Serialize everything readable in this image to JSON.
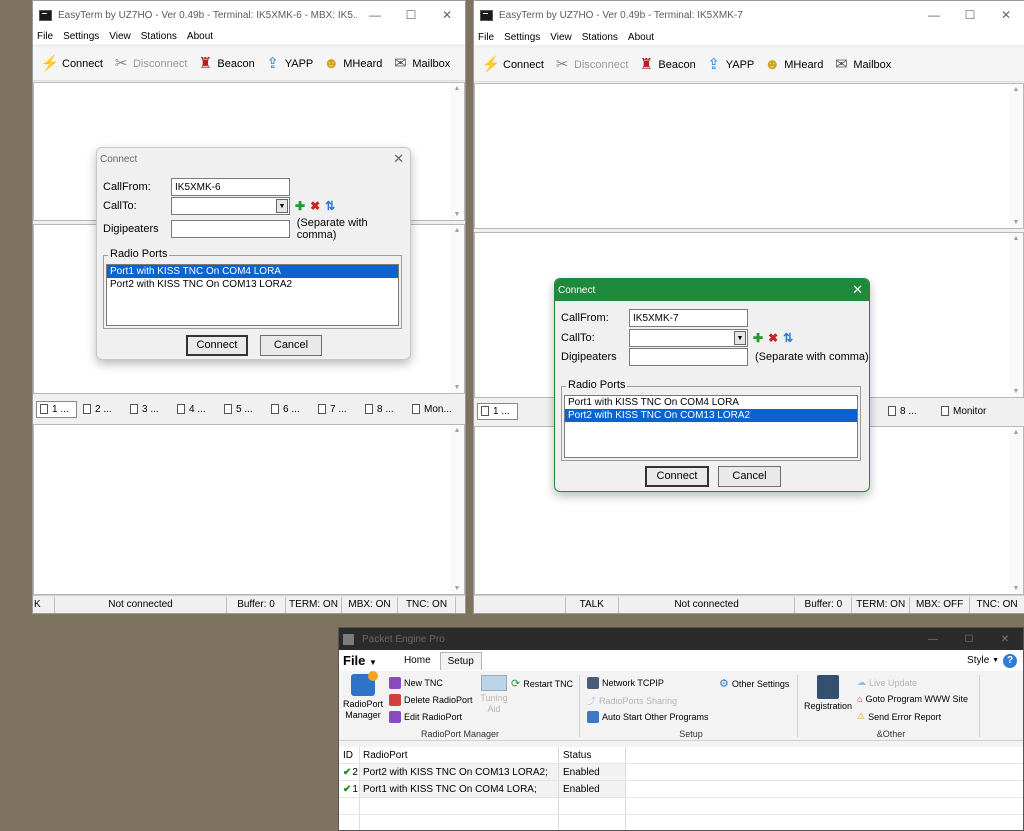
{
  "menu": [
    "File",
    "Settings",
    "View",
    "Stations",
    "About"
  ],
  "toolbar": {
    "connect": "Connect",
    "disconnect": "Disconnect",
    "beacon": "Beacon",
    "yapp": "YAPP",
    "mheard": "MHeard",
    "mailbox": "Mailbox"
  },
  "win_left": {
    "title": "EasyTerm by UZ7HO - Ver 0.49b - Terminal: IK5XMK-6 - MBX: IK5...",
    "tabs": [
      "1 ...",
      "2 ...",
      "3 ...",
      "4 ...",
      "5 ...",
      "6 ...",
      "7 ...",
      "8 ...",
      "Mon..."
    ],
    "status": [
      "K",
      "Not connected",
      "Buffer: 0",
      "TERM: ON",
      "MBX: ON",
      "TNC: ON"
    ]
  },
  "win_right": {
    "title": "EasyTerm by UZ7HO - Ver 0.49b - Terminal: IK5XMK-7",
    "tabs_left": [
      "1 ..."
    ],
    "tabs_right": [
      "8 ...",
      "Monitor"
    ],
    "status": [
      "TALK",
      "Not connected",
      "Buffer: 0",
      "TERM: ON",
      "MBX: OFF",
      "TNC: ON"
    ]
  },
  "dialog_left": {
    "title": "Connect",
    "callfrom_label": "CallFrom:",
    "callfrom_value": "IK5XMK-6",
    "callto_label": "CallTo:",
    "callto_value": "",
    "digi_label": "Digipeaters",
    "digi_value": "",
    "separate_hint": "(Separate with comma)",
    "radio_ports_label": "Radio Ports",
    "ports": [
      "Port1 with KISS TNC On COM4 LORA",
      "Port2 with KISS TNC On COM13 LORA2"
    ],
    "connect_button": "Connect",
    "cancel_button": "Cancel"
  },
  "dialog_right": {
    "title": "Connect",
    "callfrom_label": "CallFrom:",
    "callfrom_value": "IK5XMK-7",
    "callto_label": "CallTo:",
    "callto_value": "",
    "digi_label": "Digipeaters",
    "digi_value": "",
    "separate_hint": "(Separate with comma)",
    "radio_ports_label": "Radio Ports",
    "ports": [
      "Port1 with KISS TNC On COM4 LORA",
      "Port2 with KISS TNC On COM13 LORA2"
    ],
    "connect_button": "Connect",
    "cancel_button": "Cancel",
    "accent": "#1f8a3c"
  },
  "packet_engine": {
    "title": "Packet Engine Pro",
    "file_menu": "File",
    "tabs": [
      "Home",
      "Setup"
    ],
    "style_label": "Style",
    "radioport_manager_big": "RadioPort\nManager",
    "new_tnc": "New TNC",
    "delete_radioport": "Delete RadioPort",
    "edit_radioport": "Edit RadioPort",
    "tuning_aid": "Tuning\nAid",
    "restart_tnc": "Restart TNC",
    "group_radioport": "RadioPort Manager",
    "network_tcpip": "Network TCPIP",
    "radioports_sharing": "RadioPorts Sharing",
    "auto_start": "Auto Start Other Programs",
    "other_settings": "Other Settings",
    "group_setup": "Setup",
    "registration": "Registration",
    "live_update": "Live Update",
    "goto_www": "Goto Program WWW Site",
    "send_error": "Send Error Report",
    "group_other": "&Other",
    "columns": [
      "ID",
      "RadioPort",
      "Status"
    ],
    "rows": [
      {
        "id": "2",
        "port": "Port2 with KISS TNC On COM13 LORA2;",
        "status": "Enabled"
      },
      {
        "id": "1",
        "port": "Port1 with KISS TNC On COM4 LORA;",
        "status": "Enabled"
      }
    ]
  }
}
